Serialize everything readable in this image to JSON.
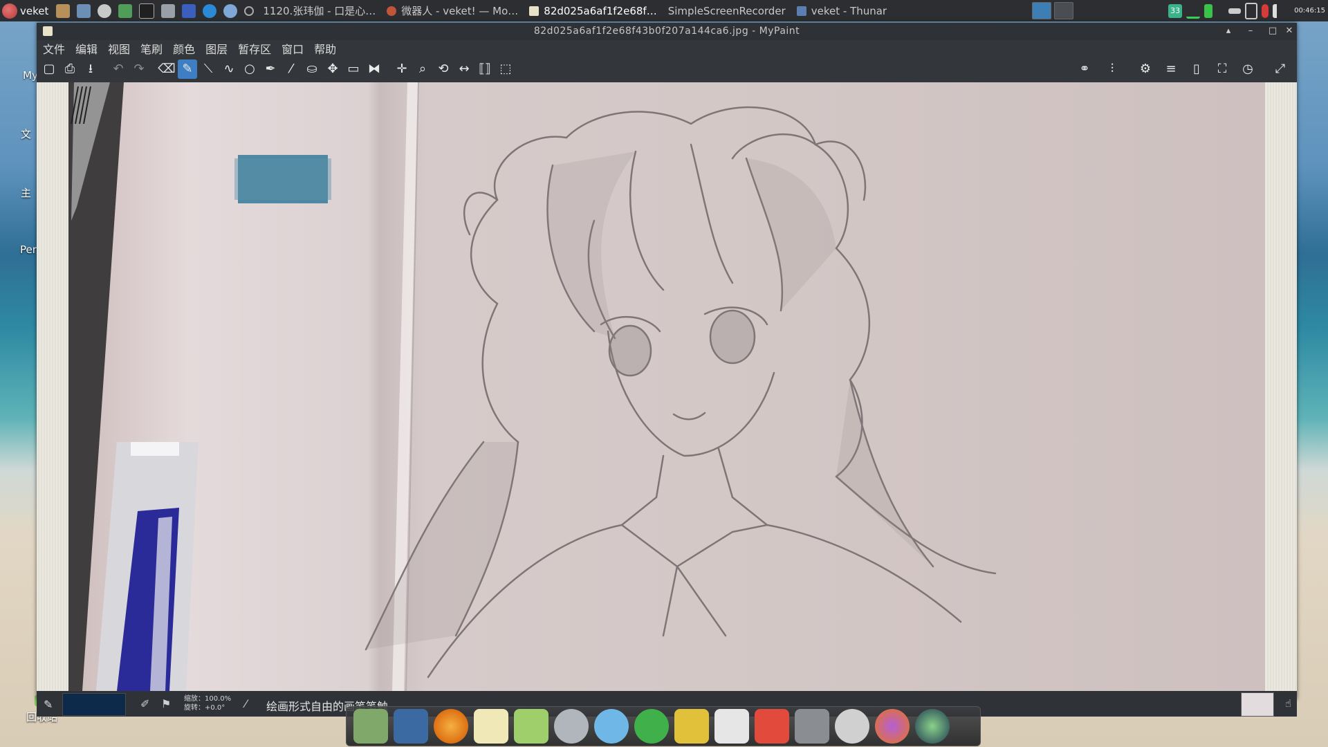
{
  "top_panel": {
    "app_label": "veket",
    "tasks": [
      {
        "label": "1120.张玮伽 - 口是心…",
        "icon": "media-icon",
        "active": false
      },
      {
        "label": "微器人 - veket! — Mo…",
        "icon": "browser-icon",
        "active": false
      },
      {
        "label": "82d025a6af1f2e68f…",
        "icon": "paint-icon",
        "active": true
      },
      {
        "label": "SimpleScreenRecorder",
        "icon": "recorder-icon",
        "active": false
      },
      {
        "label": "veket - Thunar",
        "icon": "folder-icon",
        "active": false
      }
    ],
    "battery_badge": "33",
    "clock": "00:46:15"
  },
  "desktop": {
    "labels": [
      "My",
      "文",
      "主",
      "Per"
    ],
    "trash_label": "回收站"
  },
  "window": {
    "title": "82d025a6af1f2e68f43b0f207a144ca6.jpg - MyPaint",
    "menus": [
      "文件",
      "编辑",
      "视图",
      "笔刷",
      "颜色",
      "图层",
      "暂存区",
      "窗口",
      "帮助"
    ]
  },
  "statusbar": {
    "zoom_line": "缩放：100.0%",
    "rotate_line": "旋转：+0.0°",
    "brush_description": "绘画形式自由的画笔笔触",
    "color": "#0e2a4a"
  },
  "dock": {
    "items": [
      "file-manager",
      "monitor",
      "browser",
      "notes",
      "image-editor",
      "music",
      "atom",
      "player",
      "archive",
      "charts",
      "rocket",
      "drive",
      "settings",
      "firefox",
      "camera"
    ]
  }
}
